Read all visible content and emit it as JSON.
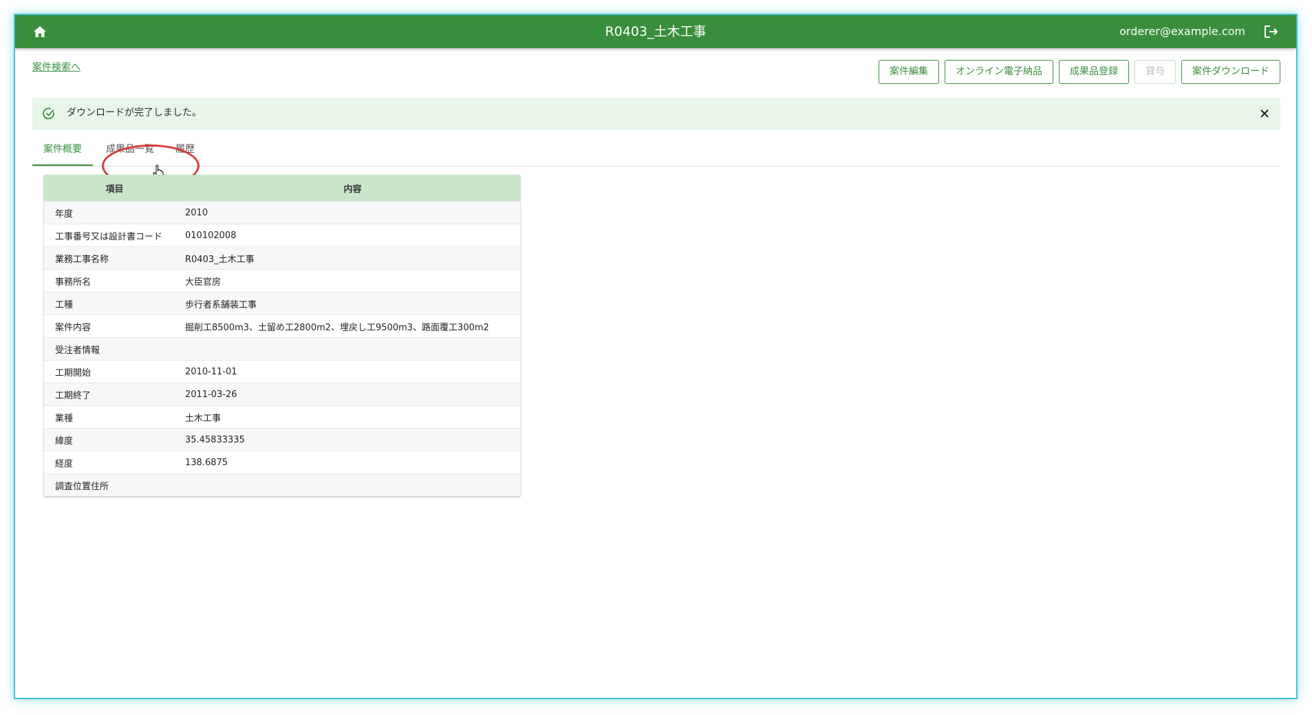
{
  "header": {
    "title": "R0403_土木工事",
    "user_email": "orderer@example.com",
    "home_icon": "home-icon",
    "logout_icon": "logout-icon",
    "bar_color": "#388e3c"
  },
  "nav": {
    "back_link": "案件検索へ"
  },
  "toolbar": {
    "buttons": [
      {
        "label": "案件編集",
        "enabled": true
      },
      {
        "label": "オンライン電子納品",
        "enabled": true
      },
      {
        "label": "成果品登録",
        "enabled": true
      },
      {
        "label": "貸与",
        "enabled": false
      },
      {
        "label": "案件ダウンロード",
        "enabled": true
      }
    ]
  },
  "alert": {
    "message": "ダウンロードが完了しました。",
    "icon": "check-circle-icon",
    "close_icon": "close-icon"
  },
  "tabs": [
    {
      "label": "案件概要",
      "active": true
    },
    {
      "label": "成果品一覧",
      "active": false
    },
    {
      "label": "履歴",
      "active": false
    }
  ],
  "table": {
    "headers": [
      "項目",
      "内容"
    ],
    "rows": [
      {
        "item": "年度",
        "value": "2010"
      },
      {
        "item": "工事番号又は設計書コード",
        "value": "010102008"
      },
      {
        "item": "業務工事名称",
        "value": "R0403_土木工事"
      },
      {
        "item": "事務所名",
        "value": "大臣官房"
      },
      {
        "item": "工種",
        "value": "歩行者系舗装工事"
      },
      {
        "item": "案件内容",
        "value": "掘削工8500m3、土留め工2800m2、埋戻し工9500m3、路面覆工300m2"
      },
      {
        "item": "受注者情報",
        "value": ""
      },
      {
        "item": "工期開始",
        "value": "2010-11-01"
      },
      {
        "item": "工期終了",
        "value": "2011-03-26"
      },
      {
        "item": "業種",
        "value": "土木工事"
      },
      {
        "item": "緯度",
        "value": "35.45833335"
      },
      {
        "item": "経度",
        "value": "138.6875"
      },
      {
        "item": "調査位置住所",
        "value": ""
      }
    ]
  }
}
